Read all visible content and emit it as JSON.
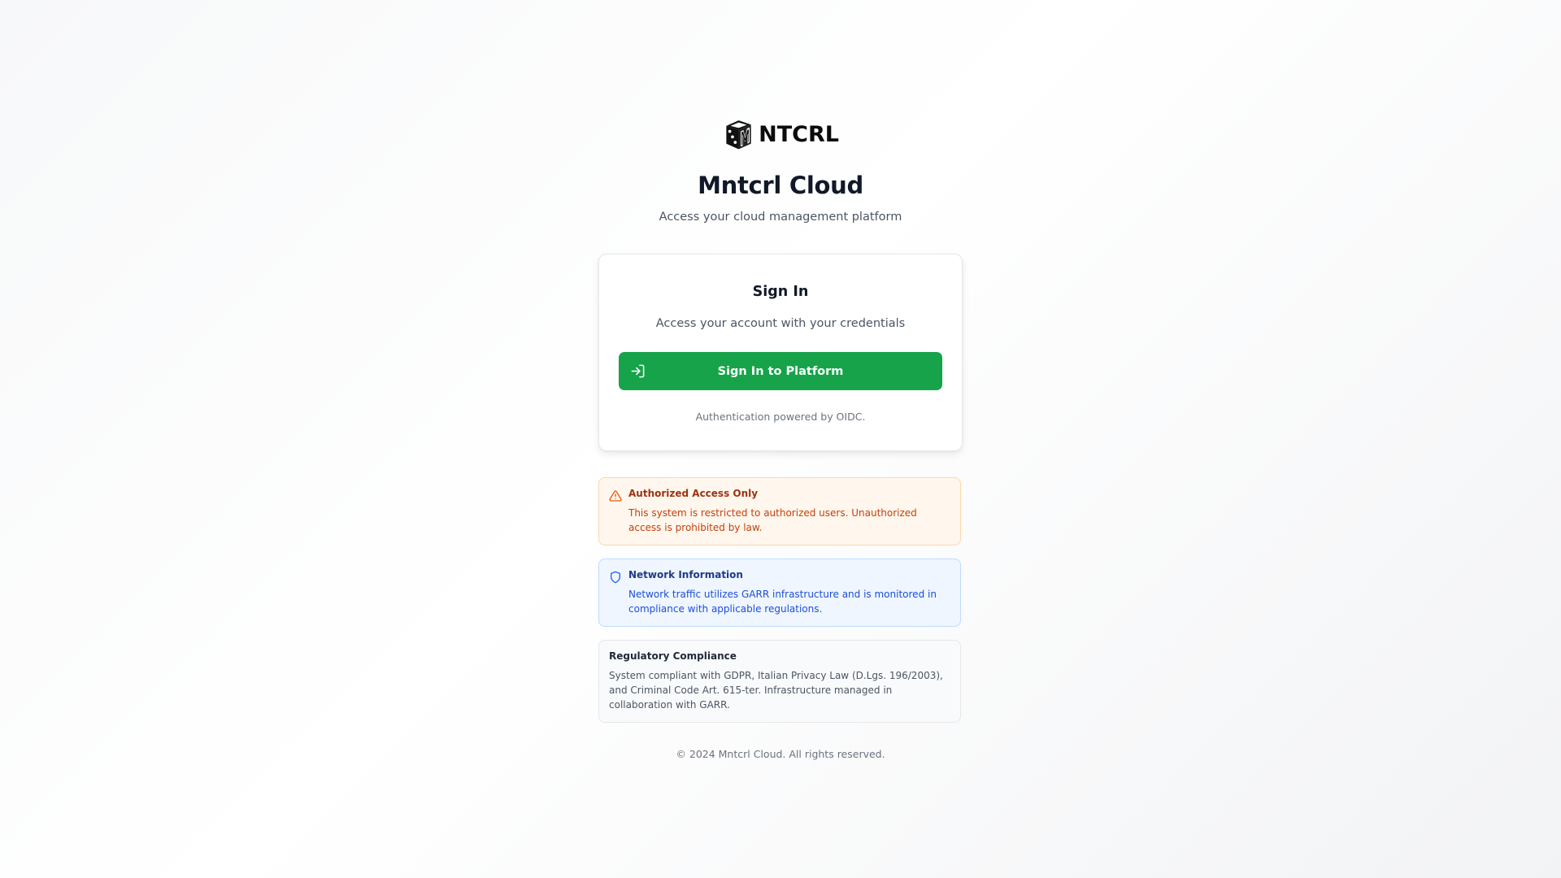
{
  "brand": {
    "logo_text": "NTCRL",
    "logo_icon": "dice-cube-logo-icon",
    "title": "Mntcrl Cloud",
    "subtitle": "Access your cloud management platform"
  },
  "signin_card": {
    "title": "Sign In",
    "subtitle": "Access your account with your credentials",
    "button_label": "Sign In to Platform",
    "button_icon": "log-in-icon",
    "footnote": "Authentication powered by OIDC."
  },
  "notices": {
    "warning": {
      "icon": "alert-triangle-icon",
      "title": "Authorized Access Only",
      "body": "This system is restricted to authorized users. Unauthorized access is prohibited by law."
    },
    "network": {
      "icon": "shield-icon",
      "title": "Network Information",
      "body": "Network traffic utilizes GARR infrastructure and is monitored in compliance with applicable regulations."
    },
    "compliance": {
      "title": "Regulatory Compliance",
      "body": "System compliant with GDPR, Italian Privacy Law (D.Lgs. 196/2003), and Criminal Code Art. 615-ter. Infrastructure managed in collaboration with GARR."
    }
  },
  "footer": {
    "copyright": "© 2024 Mntcrl Cloud. All rights reserved."
  },
  "colors": {
    "primary_button": "#16a34a",
    "warning_bg": "#fff7ed",
    "warning_text": "#c2410c",
    "info_bg": "#eff6ff",
    "info_text": "#1d4ed8",
    "neutral_bg": "#f9fafb"
  }
}
